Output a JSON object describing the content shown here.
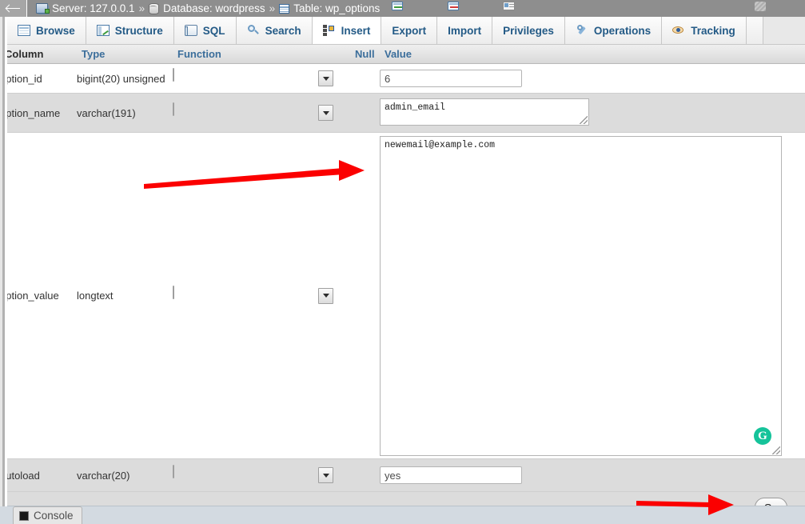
{
  "breadcrumb": {
    "back_icon": "back-arrow-icon",
    "items": [
      {
        "icon": "server-icon",
        "label": "Server: 127.0.0.1"
      },
      {
        "icon": "database-icon",
        "label": "Database: wordpress"
      },
      {
        "icon": "table-icon",
        "label": "Table: wp_options"
      }
    ],
    "separator": "»"
  },
  "tabs": [
    {
      "label": "Browse",
      "icon": "browse-icon",
      "active": false,
      "disabled": false
    },
    {
      "label": "Structure",
      "icon": "structure-icon",
      "active": false,
      "disabled": false
    },
    {
      "label": "SQL",
      "icon": "sql-icon",
      "active": false,
      "disabled": false
    },
    {
      "label": "Search",
      "icon": "search-icon",
      "active": false,
      "disabled": false
    },
    {
      "label": "Insert",
      "icon": "insert-icon",
      "active": true,
      "disabled": false
    },
    {
      "label": "Export",
      "icon": "export-icon",
      "active": false,
      "disabled": false
    },
    {
      "label": "Import",
      "icon": "import-icon",
      "active": false,
      "disabled": false
    },
    {
      "label": "Privileges",
      "icon": "privileges-icon",
      "active": false,
      "disabled": false
    },
    {
      "label": "Operations",
      "icon": "operations-icon",
      "active": false,
      "disabled": false
    },
    {
      "label": "Tracking",
      "icon": "tracking-icon",
      "active": false,
      "disabled": false
    },
    {
      "label": "",
      "icon": "triggers-icon",
      "active": false,
      "disabled": true
    }
  ],
  "table": {
    "headers": {
      "column": "Column",
      "type": "Type",
      "function": "Function",
      "null": "Null",
      "value": "Value"
    },
    "rows": [
      {
        "column": "option_id",
        "type": "bigint(20) unsigned",
        "function": "",
        "null": "",
        "value": "6",
        "control": "input"
      },
      {
        "column": "option_name",
        "type": "varchar(191)",
        "function": "",
        "null": "",
        "value": "admin_email",
        "control": "textarea-small"
      },
      {
        "column": "option_value",
        "type": "longtext",
        "function": "",
        "null": "",
        "value": "newemail@example.com",
        "control": "textarea-large"
      },
      {
        "column": "autoload",
        "type": "varchar(20)",
        "function": "",
        "null": "",
        "value": "yes",
        "control": "input"
      }
    ]
  },
  "footer": {
    "go_label": "Go"
  },
  "bottom": {
    "console_label": "Console",
    "console_icon": "console-icon"
  },
  "overlay": {
    "grammarly_badge": "G",
    "annotations": [
      {
        "name": "arrow-to-option-value-field",
        "color": "#fb0000"
      },
      {
        "name": "arrow-to-go-button",
        "color": "#fb0000"
      }
    ]
  },
  "colors": {
    "breadcrumb_bg": "#8e8e8e",
    "tab_link": "#235a86",
    "row_alt_bg": "#dcdcdc",
    "annotation_red": "#fb0000",
    "grammarly_green": "#15c39a"
  }
}
